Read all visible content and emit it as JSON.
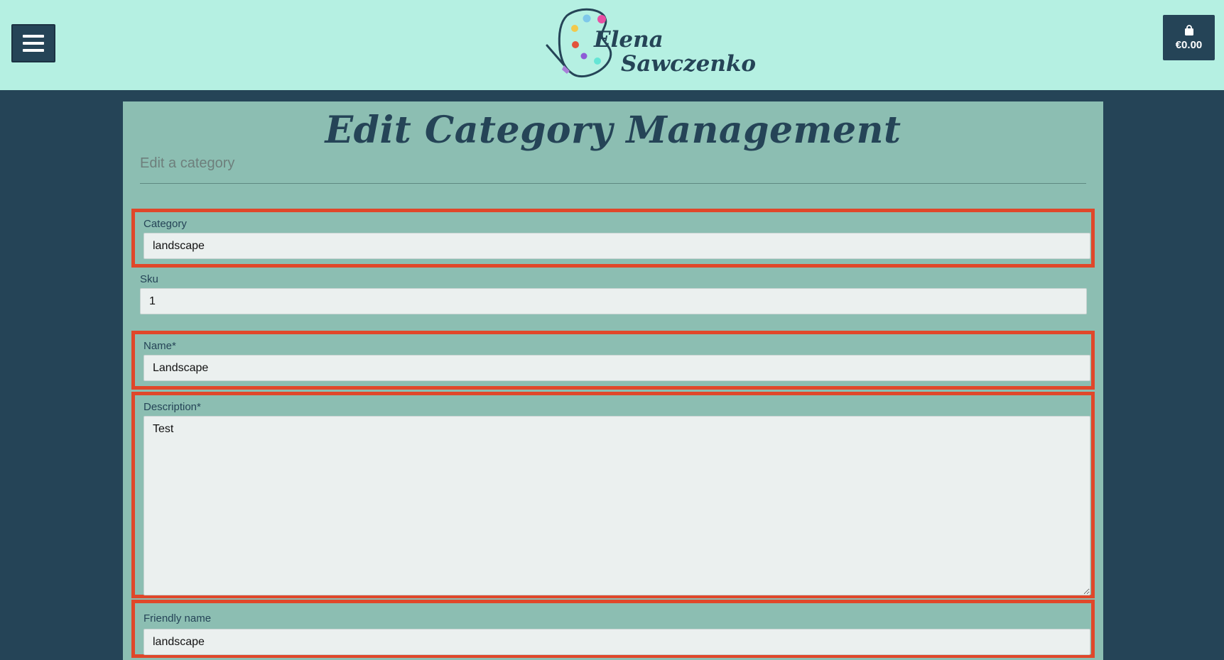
{
  "header": {
    "menu_icon": "hamburger-menu-icon",
    "logo": {
      "line1": "Elena",
      "line2": "Sawczenko",
      "palette_colors": [
        "#7ec8ea",
        "#e84fa3",
        "#f2c94c",
        "#e3533b",
        "#8e5bd6",
        "#65e5d5"
      ]
    },
    "bag": {
      "icon": "shopping-bag-icon",
      "total": "€0.00"
    }
  },
  "page": {
    "title": "Edit Category Management",
    "subtitle": "Edit a category"
  },
  "form": {
    "category": {
      "label": "Category",
      "value": "landscape"
    },
    "sku": {
      "label": "Sku",
      "value": "1"
    },
    "name": {
      "label": "Name*",
      "value": "Landscape"
    },
    "description": {
      "label": "Description*",
      "value": "Test"
    },
    "friendly_name": {
      "label": "Friendly name",
      "value": "landscape"
    }
  },
  "colors": {
    "header_bg": "#b5f0e2",
    "page_bg": "#254457",
    "panel_bg": "#8cbeb2",
    "highlight": "#e0472a"
  }
}
